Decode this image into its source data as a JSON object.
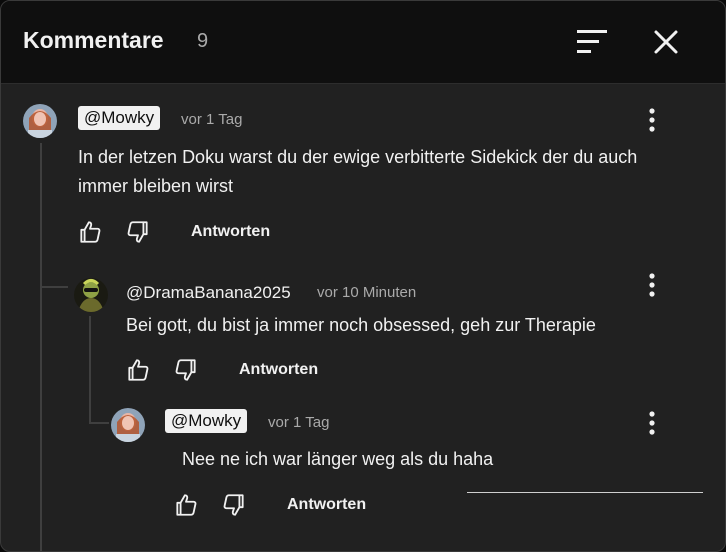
{
  "header": {
    "title": "Kommentare",
    "count": "9"
  },
  "comments": [
    {
      "handle": "@Mowky",
      "time": "vor 1 Tag",
      "text": "In der letzen Doku warst du der ewige verbitterte Sidekick der du auch immer bleiben wirst",
      "reply_label": "Antworten"
    },
    {
      "handle": "@DramaBanana2025",
      "time": "vor 10 Minuten",
      "text": "Bei gott, du bist ja immer noch obsessed, geh zur Therapie",
      "reply_label": "Antworten"
    },
    {
      "handle": "@Mowky",
      "time": "vor 1 Tag",
      "text": "Nee ne ich war länger weg als du haha",
      "reply_label": "Antworten"
    }
  ],
  "colors": {
    "background": "#212121",
    "header": "#0f0f0f",
    "text": "#f1f1f1",
    "muted": "#aaaaaa"
  }
}
